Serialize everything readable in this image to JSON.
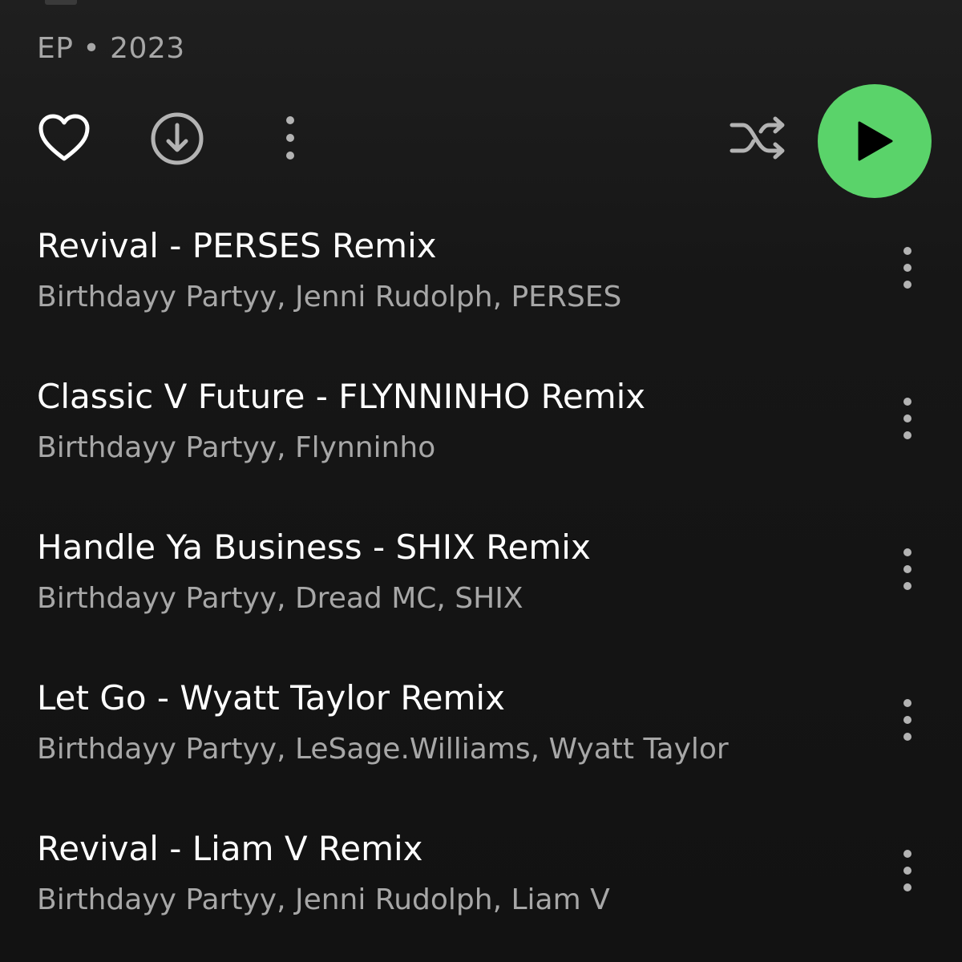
{
  "album": {
    "meta": "EP • 2023"
  },
  "actions": {
    "like_icon": "heart-icon",
    "download_icon": "download-circle-icon",
    "more_icon": "more-vertical-icon",
    "shuffle_icon": "shuffle-icon",
    "play_icon": "play-icon",
    "accent_color": "#1ed760"
  },
  "tracks": [
    {
      "title": "Revival - PERSES Remix",
      "artists": "Birthdayy Partyy, Jenni Rudolph, PERSES"
    },
    {
      "title": "Classic V Future - FLYNNINHO Remix",
      "artists": "Birthdayy Partyy, Flynninho"
    },
    {
      "title": "Handle Ya Business - SHIX Remix",
      "artists": "Birthdayy Partyy, Dread MC, SHIX"
    },
    {
      "title": "Let Go - Wyatt Taylor Remix",
      "artists": "Birthdayy Partyy, LeSage.Williams, Wyatt Taylor"
    },
    {
      "title": "Revival - Liam V Remix",
      "artists": "Birthdayy Partyy, Jenni Rudolph, Liam V"
    }
  ]
}
